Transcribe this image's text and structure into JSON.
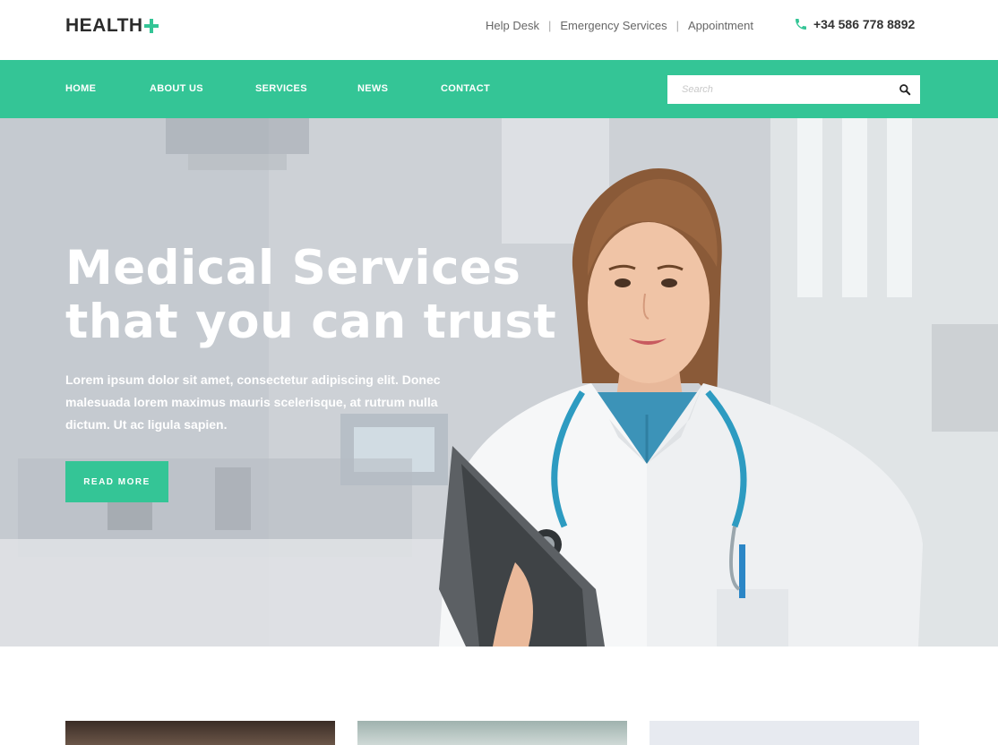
{
  "brand": {
    "name": "HEALTH",
    "accent_color": "#34c596"
  },
  "top_links": [
    "Help Desk",
    "Emergency Services",
    "Appointment"
  ],
  "phone": {
    "icon": "phone-icon",
    "number": "+34 586 778 8892"
  },
  "nav": {
    "items": [
      "HOME",
      "ABOUT US",
      "SERVICES",
      "NEWS",
      "CONTACT"
    ],
    "search": {
      "placeholder": "Search",
      "icon": "search-icon"
    }
  },
  "hero": {
    "title_line1": "Medical Services",
    "title_line2": "that you can trust",
    "text": "Lorem ipsum dolor sit amet, consectetur adipiscing elit. Donec malesuada lorem maximus mauris scelerisque, at rutrum nulla dictum. Ut ac ligula sapien.",
    "button": "READ MORE",
    "image": "doctor-photo"
  }
}
